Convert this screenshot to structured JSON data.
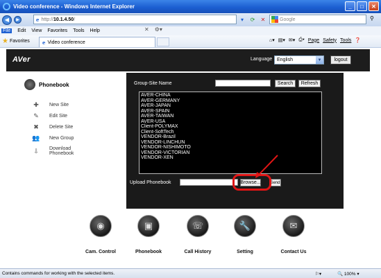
{
  "window": {
    "title": "Video conference - Windows Internet Explorer",
    "controls": [
      "_",
      "□",
      "✕"
    ]
  },
  "address_bar": {
    "url_prefix": "http://",
    "url_host": "10.1.4.50",
    "url_suffix": "/",
    "search_placeholder": "Google"
  },
  "menu": [
    "File",
    "Edit",
    "View",
    "Favorites",
    "Tools",
    "Help"
  ],
  "favorites_bar": {
    "favorites_label": "Favorites",
    "tab_title": "Video conference",
    "commands": [
      "Page",
      "Safety",
      "Tools"
    ]
  },
  "header": {
    "logo": "AVer",
    "language_label": "Language",
    "language_value": "English",
    "logout_label": "logout"
  },
  "sidebar": {
    "title": "Phonebook",
    "items": [
      {
        "label": "New Site",
        "icon": "add-user-icon"
      },
      {
        "label": "Edit Site",
        "icon": "edit-user-icon"
      },
      {
        "label": "Delete Site",
        "icon": "delete-user-icon"
      },
      {
        "label": "New Group",
        "icon": "group-icon"
      },
      {
        "label_line1": "Download",
        "label_line2": "Phonebook",
        "icon": "download-icon"
      }
    ]
  },
  "panel": {
    "group_site_label": "Group-Site Name",
    "search_label": "Search",
    "refresh_label": "Refresh",
    "sites": [
      "AVER-CHINA",
      "AVER-GERMANY",
      "AVER-JAPAN",
      "AVER-SPAIN",
      "AVER-TAIWAN",
      "AVER-USA",
      "Client-POLYMAX",
      "Client-SoftTech",
      "VENDOR-Brazil",
      "VENDOR-LINCHUN",
      "VENDOR-NISHIMOTO",
      "VENDOR-VICTORIAN",
      "VENDOR-XEN"
    ],
    "upload_label": "Upload Phonebook",
    "browse_label": "Browse...",
    "send_label": "Send",
    "highlight_color": "#e01515"
  },
  "bottom_nav": [
    {
      "label": "Cam. Control",
      "icon": "camera-icon"
    },
    {
      "label": "Phonebook",
      "icon": "phonebook-icon"
    },
    {
      "label": "Call History",
      "icon": "call-history-icon"
    },
    {
      "label": "Setting",
      "icon": "wrench-icon"
    },
    {
      "label": "Contact Us",
      "icon": "envelope-icon"
    }
  ],
  "status_bar": {
    "text": "Contains commands for working with the selected items.",
    "zoom": "100%"
  }
}
